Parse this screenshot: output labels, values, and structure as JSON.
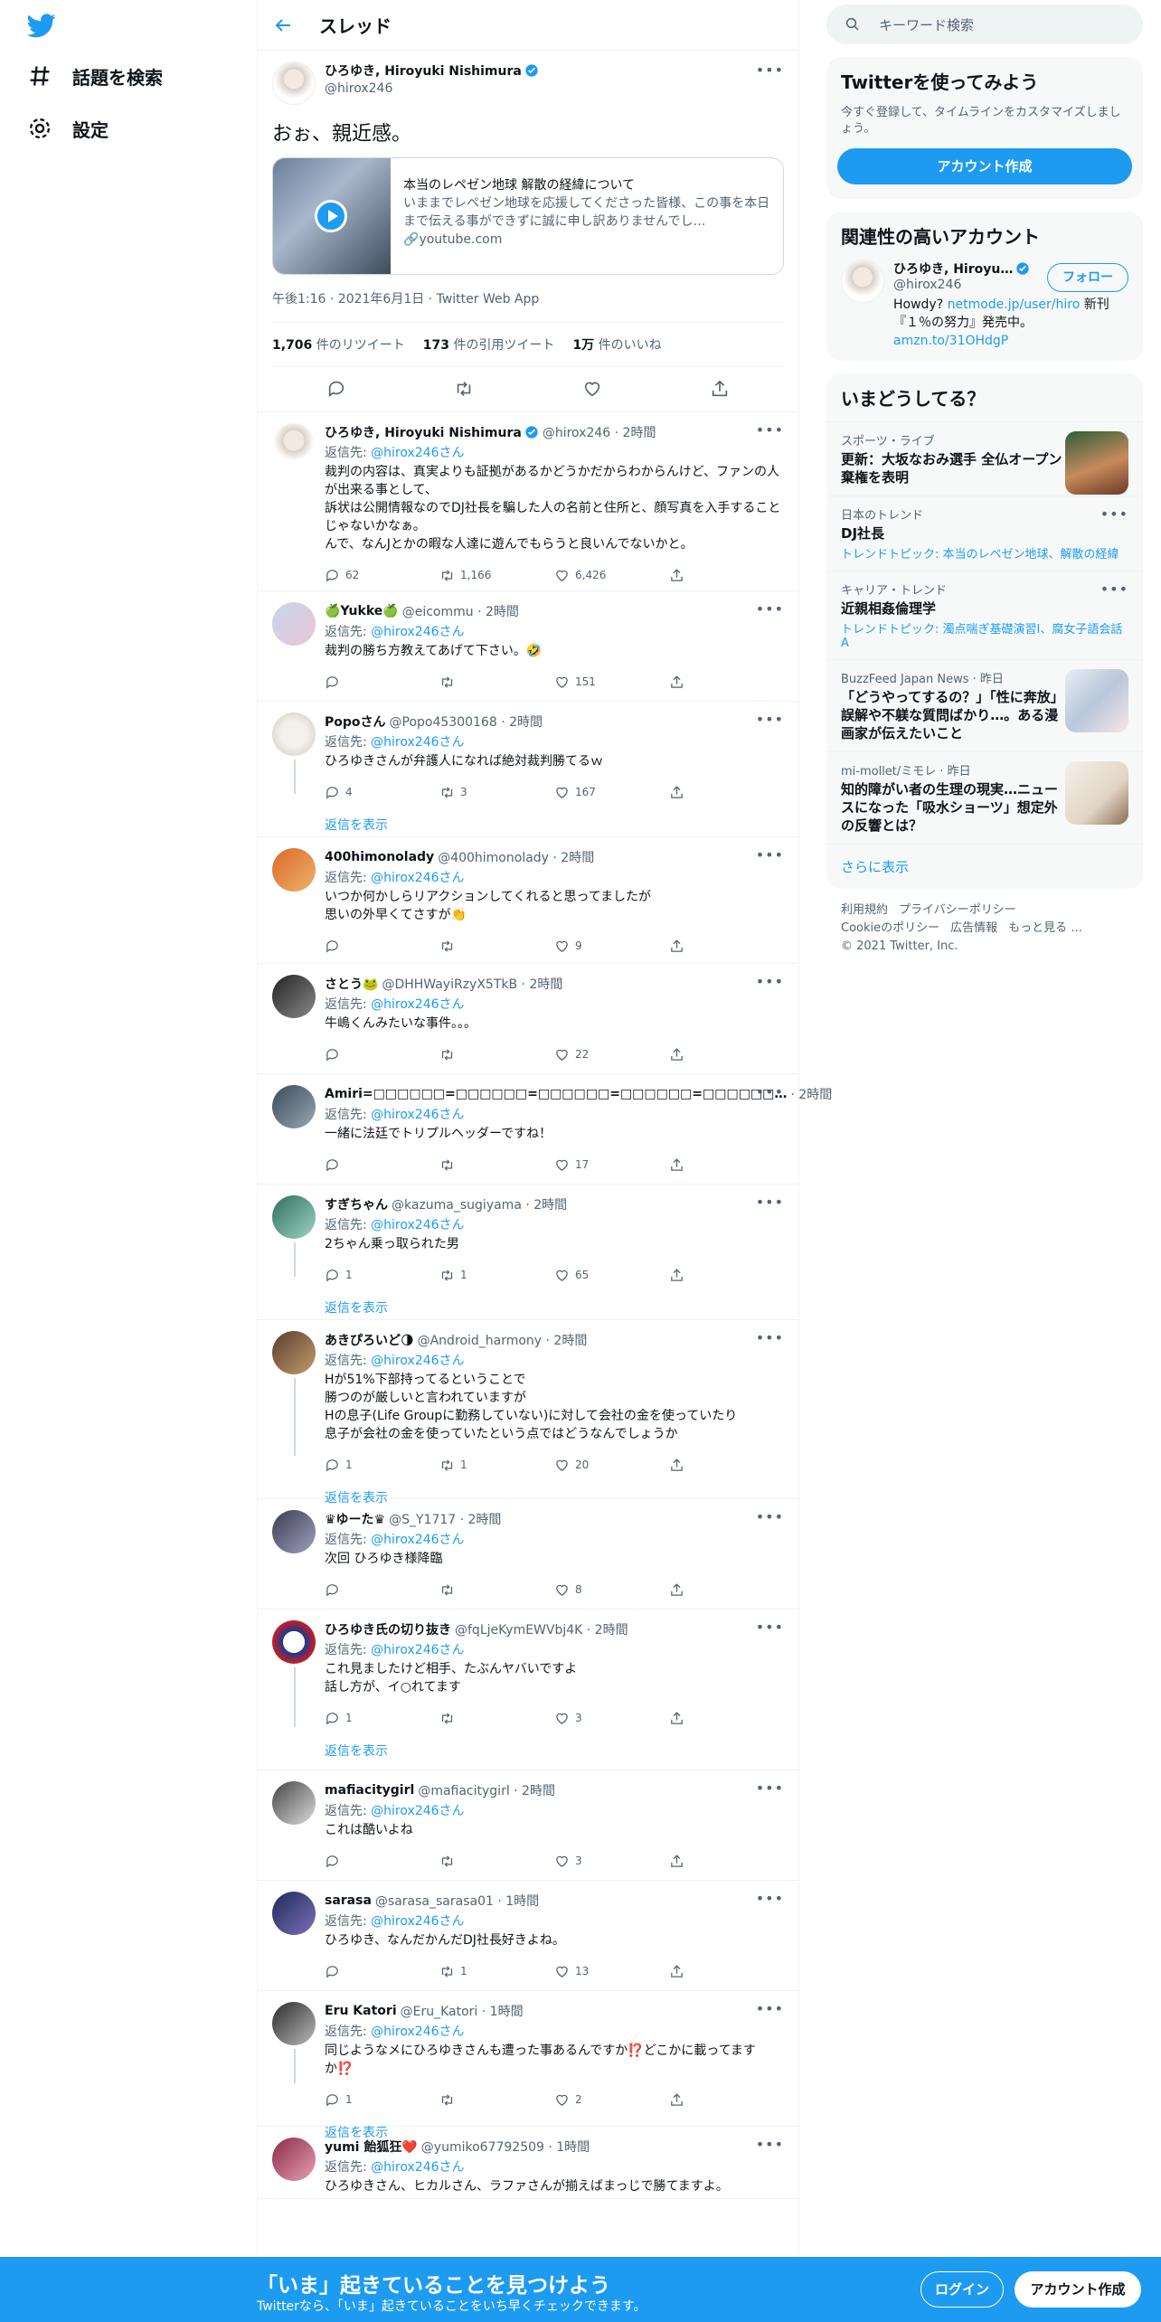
{
  "nav": {
    "explore": "話題を検索",
    "settings": "設定"
  },
  "header": {
    "title": "スレッド"
  },
  "main": {
    "name": "ひろゆき, Hiroyuki Nishimura",
    "handle": "@hirox246",
    "text": "おぉ、親近感。",
    "card": {
      "title": "本当のレペゼン地球 解散の経緯について",
      "desc": "いままでレペゼン地球を応援してくださった皆様、この事を本日まで伝える事ができずに誠に申し訳ありませんでし…",
      "domain": "youtube.com"
    },
    "time": "午後1:16 · 2021年6月1日 · Twitter Web App",
    "stats": {
      "rt_num": "1,706",
      "rt_label": "件のリツイート",
      "quote_num": "173",
      "quote_label": "件の引用ツイート",
      "like_num": "1万",
      "like_label": "件のいいね"
    }
  },
  "reply_to_label": "返信先: ",
  "reply_to_handle": "@hirox246",
  "reply_to_suffix": "さん",
  "show_replies": "返信を表示",
  "replies": [
    {
      "name": "ひろゆき, Hiroyuki Nishimura",
      "meta": "@hirox246 · 2時間",
      "text": "裁判の内容は、真実よりも証拠があるかどうかだからわからんけど、ファンの人が出来る事として、\n訴状は公開情報なのでDJ社長を騙した人の名前と住所と、顔写真を入手することじゃないかなぁ。\nんで、なんJとかの暇な人達に遊んでもらうと良いんでないかと。",
      "reply": "62",
      "rt": "1,166",
      "like": "6,426"
    },
    {
      "name": "🍏Yukke🍏",
      "meta": "@eicommu · 2時間",
      "text": "裁判の勝ち方教えてあげて下さい。🤣",
      "reply": "",
      "rt": "",
      "like": "151"
    },
    {
      "name": "Popoさん",
      "meta": "@Popo45300168 · 2時間",
      "text": "ひろゆきさんが弁護人になれば絶対裁判勝てるｗ",
      "reply": "4",
      "rt": "3",
      "like": "167"
    },
    {
      "name": "400himonolady",
      "meta": "@400himonolady · 2時間",
      "text": "いつか何かしらリアクションしてくれると思ってましたが\n思いの外早くてさすが👏",
      "reply": "",
      "rt": "",
      "like": "9"
    },
    {
      "name": "さとう🐸",
      "meta": "@DHHWayiRzyX5TkB · 2時間",
      "text": "牛嶋くんみたいな事件。。。",
      "reply": "",
      "rt": "",
      "like": "22"
    },
    {
      "name": "Amiri=□□□□□□=□□□□□□=□□□□□□=□□□□□□=□□□□□□…",
      "meta": "· 2時間",
      "text": "一緒に法廷でトリプルヘッダーですね！",
      "reply": "",
      "rt": "",
      "like": "17"
    },
    {
      "name": "すぎちゃん",
      "meta": "@kazuma_sugiyama · 2時間",
      "text": "2ちゃん乗っ取られた男",
      "reply": "1",
      "rt": "1",
      "like": "65"
    },
    {
      "name": "あきぴろいど🌗",
      "meta": "@Android_harmony · 2時間",
      "text": "Hが51%下部持ってるということで\n勝つのが厳しいと言われていますが\nHの息子(Life Groupに勤務していない)に対して会社の金を使っていたり\n息子が会社の金を使っていたという点ではどうなんでしょうか",
      "reply": "1",
      "rt": "1",
      "like": "20"
    },
    {
      "name": "♛ゆーた♛",
      "meta": "@S_Y1717 · 2時間",
      "text": "次回 ひろゆき様降臨",
      "reply": "",
      "rt": "",
      "like": "8"
    },
    {
      "name": "ひろゆき氏の切り抜き",
      "meta": "@fqLjeKymEWVbj4K · 2時間",
      "text": "これ見ましたけど相手、たぶんヤバいですよ\n話し方が、イ○れてます",
      "reply": "1",
      "rt": "",
      "like": "3"
    },
    {
      "name": "mafiacitygirl",
      "meta": "@mafiacitygirl · 2時間",
      "text": "これは酷いよね",
      "reply": "",
      "rt": "",
      "like": "3"
    },
    {
      "name": "sarasa",
      "meta": "@sarasa_sarasa01 · 1時間",
      "text": "ひろゆき、なんだかんだDJ社長好きよね。",
      "reply": "",
      "rt": "1",
      "like": "13"
    },
    {
      "name": "Eru Katori",
      "meta": "@Eru_Katori · 1時間",
      "text": "同じようなメにひろゆきさんも遭った事あるんですか⁉️どこかに載ってますか⁉️",
      "reply": "1",
      "rt": "",
      "like": "2"
    },
    {
      "name": "yumi 飴狐狂❤️",
      "meta": "@yumiko67792509 · 1時間",
      "text": "ひろゆきさん、ヒカルさん、ラファさんが揃えばまっじで勝てますよ。",
      "reply": "",
      "rt": "",
      "like": ""
    }
  ],
  "right": {
    "search_placeholder": "キーワード検索",
    "signup": {
      "title": "Twitterを使ってみよう",
      "desc": "今すぐ登録して、タイムラインをカスタマイズしましょう。",
      "button": "アカウント作成"
    },
    "related": {
      "title": "関連性の高いアカウント",
      "name": "ひろゆき, Hiroyu…",
      "handle": "@hirox246",
      "follow": "フォロー",
      "bio_pre": "Howdy? ",
      "bio_link": "netmode.jp/user/hiro",
      "bio_mid": " 新刊『１％の努力』発売中。",
      "bio_link2": "amzn.to/31OHdgP"
    },
    "trends_title": "いまどうしてる？",
    "trends": [
      {
        "cat": "スポーツ・ライブ",
        "title": "更新：大坂なおみ選手 全仏オープン棄権を表明",
        "sub": ""
      },
      {
        "cat": "日本のトレンド",
        "title": "DJ社長",
        "sub": "トレンドトピック: 本当のレペゼン地球、解散の経緯"
      },
      {
        "cat": "キャリア・トレンド",
        "title": "近親相姦倫理学",
        "sub": "トレンドトピック: 濁点喘ぎ基礎演習I、腐女子語会話A"
      },
      {
        "cat": "BuzzFeed Japan News · 昨日",
        "title": "「どうやってするの？」「性に奔放」誤解や不躾な質問ばかり…。ある漫画家が伝えたいこと",
        "sub": ""
      },
      {
        "cat": "mi-mollet/ミモレ · 昨日",
        "title": "知的障がい者の生理の現実…ニュースになった「吸水ショーツ」想定外の反響とは？",
        "sub": ""
      }
    ],
    "more": "さらに表示",
    "footer": [
      "利用規約",
      "プライバシーポリシー",
      "Cookieのポリシー",
      "広告情報",
      "もっと見る …",
      "© 2021 Twitter, Inc."
    ]
  },
  "bottom": {
    "title": "「いま」起きていることを見つけよう",
    "sub": "Twitterなら、「いま」起きていることをいち早くチェックできます。",
    "login": "ログイン",
    "register": "アカウント作成"
  }
}
